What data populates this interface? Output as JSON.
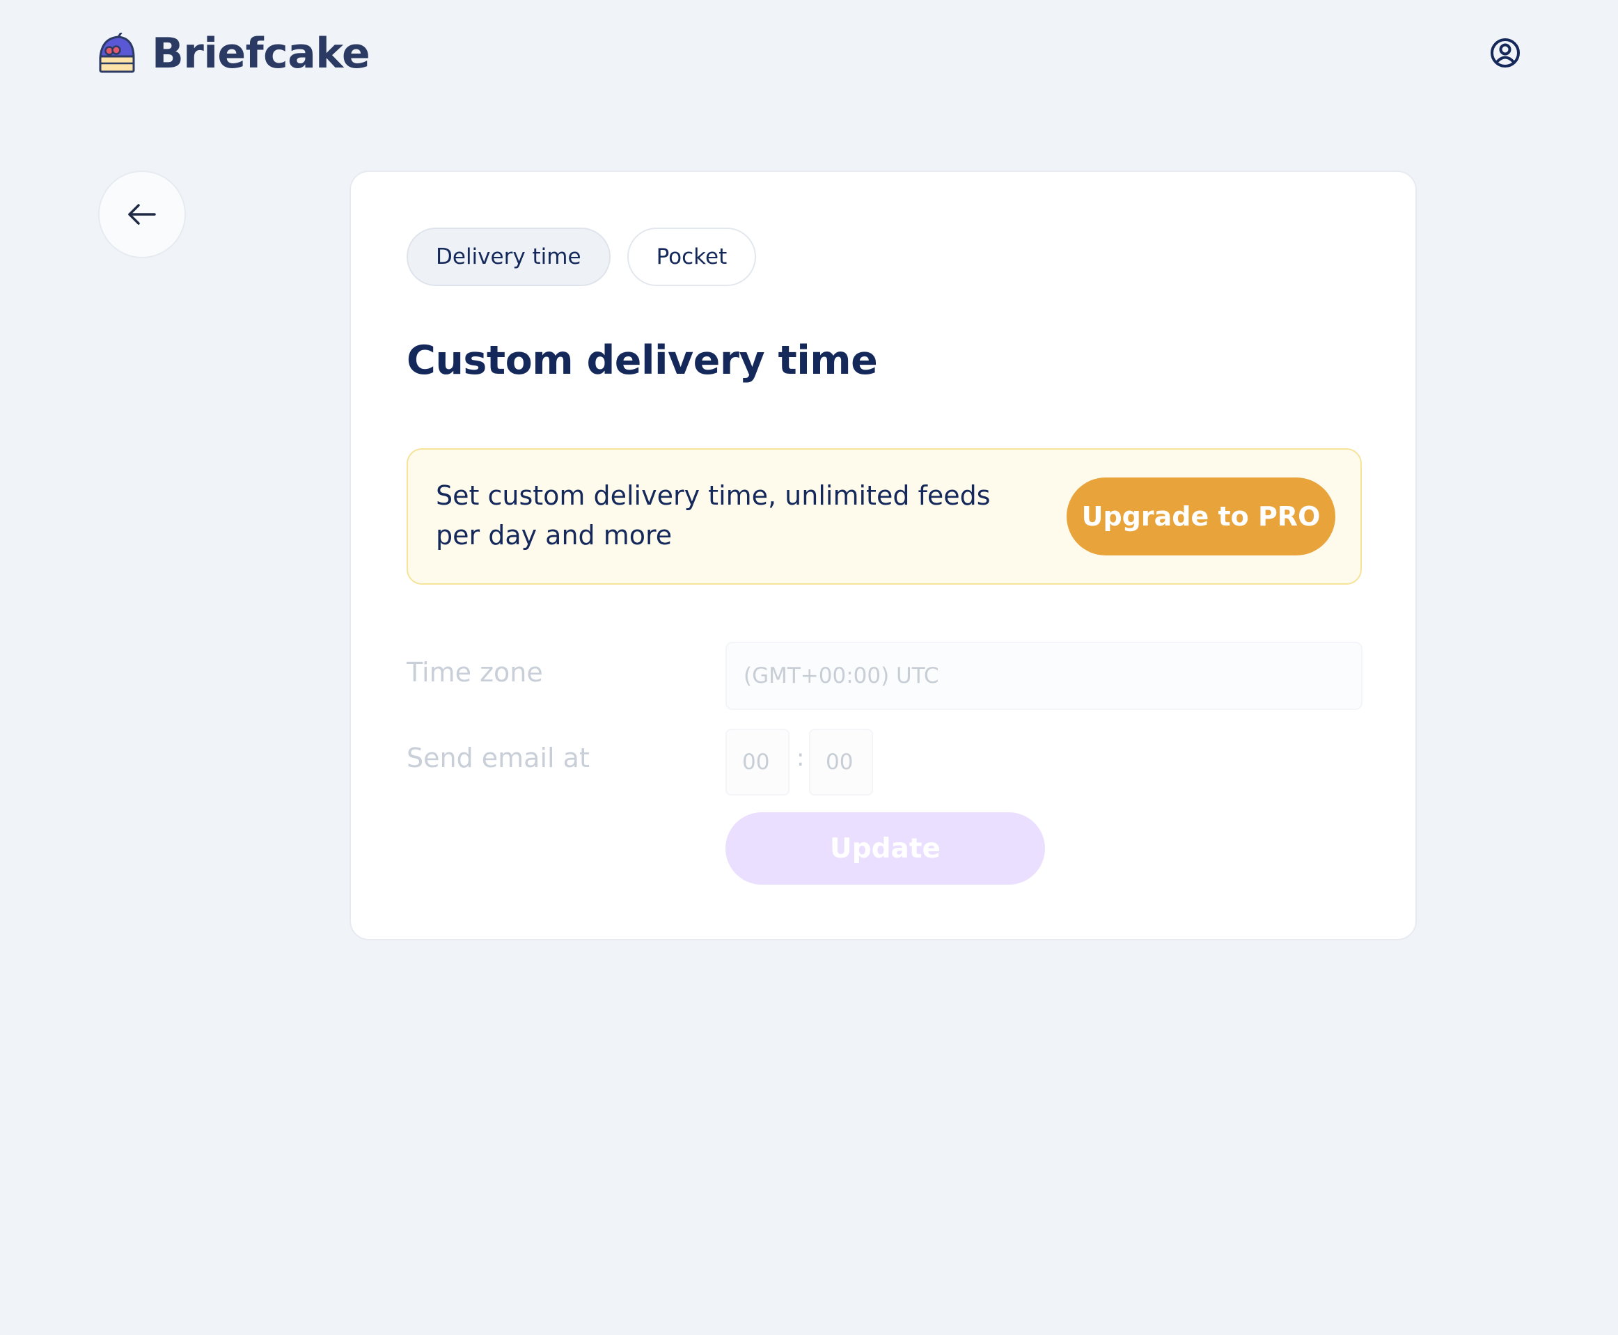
{
  "brand": {
    "name": "Briefcake",
    "logo_icon": "cake-slice-icon"
  },
  "header": {
    "account_icon": "user-circle-icon"
  },
  "nav": {
    "back_icon": "arrow-left-icon"
  },
  "tabs": [
    {
      "label": "Delivery time",
      "active": true
    },
    {
      "label": "Pocket",
      "active": false
    }
  ],
  "page": {
    "title": "Custom delivery time"
  },
  "promo": {
    "text": "Set custom delivery time, unlimited feeds per day and more",
    "button_label": "Upgrade to PRO"
  },
  "form": {
    "timezone_label": "Time zone",
    "timezone_value": "(GMT+00:00) UTC",
    "send_label": "Send email at",
    "hour_value": "00",
    "minute_value": "00",
    "separator": ":",
    "update_label": "Update"
  },
  "colors": {
    "background": "#f0f4f9",
    "text_primary": "#14285a",
    "promo_bg": "#fefbec",
    "promo_border": "#f5e39a",
    "upgrade_button": "#e8a33b",
    "update_button_disabled": "#eadffe"
  }
}
